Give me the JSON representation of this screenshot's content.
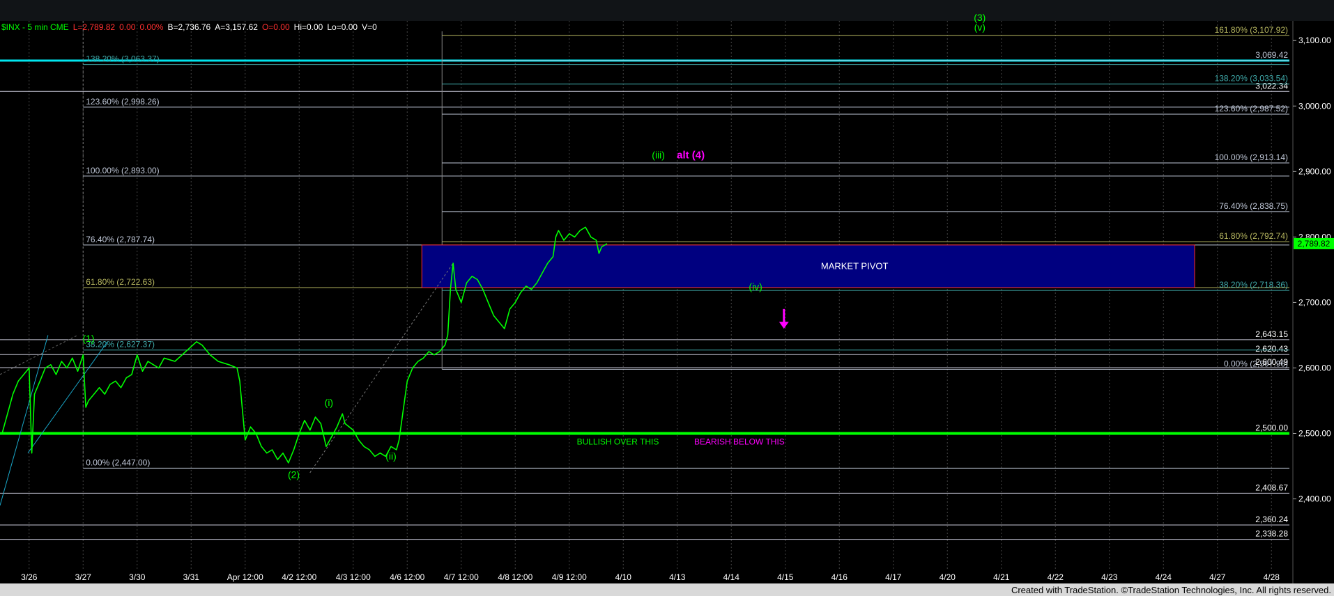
{
  "header": {
    "symbol": "$INX - 5 min CME",
    "last": "L=2,789.82",
    "change": "0.00",
    "change_pct": "0.00%",
    "bid": "B=2,736.76",
    "ask": "A=3,157.62",
    "open": "O=0.00",
    "high": "Hi=0.00",
    "low": "Lo=0.00",
    "volume": "V=0"
  },
  "footer": {
    "credit": "Created with TradeStation. ©TradeStation Technologies, Inc. All rights reserved."
  },
  "colors": {
    "background": "#000000",
    "price": "#00ff00",
    "cyan_line": "#00e5ee",
    "zone_fill": "#000080",
    "zone_border": "#ff2a2a",
    "magenta": "#ff00ff",
    "fib_white": "#c0c8d8",
    "fib_teal": "#3fa9a9",
    "fib_olive": "#b8b860"
  },
  "chart_data": {
    "type": "line",
    "title": "",
    "ylim": [
      2290,
      3130
    ],
    "y_ticks": [
      {
        "v": 2400,
        "label": "2,400.00"
      },
      {
        "v": 2500,
        "label": "2,500.00"
      },
      {
        "v": 2600,
        "label": "2,600.00"
      },
      {
        "v": 2700,
        "label": "2,700.00"
      },
      {
        "v": 2800,
        "label": "2,800.00"
      },
      {
        "v": 2900,
        "label": "2,900.00"
      },
      {
        "v": 3000,
        "label": "3,000.00"
      },
      {
        "v": 3100,
        "label": "3,100.00"
      }
    ],
    "x_ticks": [
      {
        "i": 0.5,
        "label": "3/26"
      },
      {
        "i": 1.5,
        "label": "3/27"
      },
      {
        "i": 2.5,
        "label": "3/30"
      },
      {
        "i": 3.5,
        "label": "3/31"
      },
      {
        "i": 4.5,
        "label": "Apr 12:00"
      },
      {
        "i": 5.5,
        "label": "4/2 12:00"
      },
      {
        "i": 6.5,
        "label": "4/3 12:00"
      },
      {
        "i": 7.5,
        "label": "4/6 12:00"
      },
      {
        "i": 8.5,
        "label": "4/7 12:00"
      },
      {
        "i": 9.5,
        "label": "4/8 12:00"
      },
      {
        "i": 10.5,
        "label": "4/9 12:00"
      },
      {
        "i": 11.5,
        "label": "4/10"
      },
      {
        "i": 12.5,
        "label": "4/13"
      },
      {
        "i": 13.5,
        "label": "4/14"
      },
      {
        "i": 14.5,
        "label": "4/15"
      },
      {
        "i": 15.5,
        "label": "4/16"
      },
      {
        "i": 16.5,
        "label": "4/17"
      },
      {
        "i": 17.5,
        "label": "4/20"
      },
      {
        "i": 18.5,
        "label": "4/21"
      },
      {
        "i": 19.5,
        "label": "4/22"
      },
      {
        "i": 20.5,
        "label": "4/23"
      },
      {
        "i": 21.5,
        "label": "4/24"
      },
      {
        "i": 22.5,
        "label": "4/27"
      },
      {
        "i": 23.5,
        "label": "4/28"
      }
    ],
    "current_price": {
      "value": 2789.82,
      "label": "2,789.82"
    },
    "series": [
      {
        "points": [
          [
            0.0,
            2500
          ],
          [
            0.1,
            2530
          ],
          [
            0.2,
            2560
          ],
          [
            0.3,
            2580
          ],
          [
            0.4,
            2590
          ],
          [
            0.5,
            2600
          ],
          [
            0.55,
            2470
          ],
          [
            0.6,
            2560
          ],
          [
            0.7,
            2580
          ],
          [
            0.8,
            2600
          ],
          [
            0.9,
            2605
          ],
          [
            1.0,
            2590
          ],
          [
            1.1,
            2610
          ],
          [
            1.2,
            2600
          ],
          [
            1.3,
            2615
          ],
          [
            1.4,
            2595
          ],
          [
            1.5,
            2620
          ],
          [
            1.55,
            2540
          ],
          [
            1.6,
            2550
          ],
          [
            1.7,
            2560
          ],
          [
            1.8,
            2570
          ],
          [
            1.9,
            2560
          ],
          [
            2.0,
            2575
          ],
          [
            2.1,
            2580
          ],
          [
            2.2,
            2570
          ],
          [
            2.3,
            2585
          ],
          [
            2.4,
            2590
          ],
          [
            2.5,
            2620
          ],
          [
            2.6,
            2595
          ],
          [
            2.7,
            2610
          ],
          [
            2.8,
            2605
          ],
          [
            2.9,
            2600
          ],
          [
            3.0,
            2615
          ],
          [
            3.2,
            2610
          ],
          [
            3.4,
            2625
          ],
          [
            3.6,
            2640
          ],
          [
            3.7,
            2635
          ],
          [
            3.85,
            2620
          ],
          [
            4.0,
            2610
          ],
          [
            4.2,
            2605
          ],
          [
            4.35,
            2600
          ],
          [
            4.4,
            2580
          ],
          [
            4.5,
            2490
          ],
          [
            4.6,
            2510
          ],
          [
            4.7,
            2500
          ],
          [
            4.8,
            2480
          ],
          [
            4.9,
            2470
          ],
          [
            5.0,
            2475
          ],
          [
            5.1,
            2460
          ],
          [
            5.2,
            2470
          ],
          [
            5.3,
            2455
          ],
          [
            5.4,
            2475
          ],
          [
            5.5,
            2500
          ],
          [
            5.6,
            2520
          ],
          [
            5.7,
            2505
          ],
          [
            5.8,
            2525
          ],
          [
            5.9,
            2515
          ],
          [
            6.0,
            2480
          ],
          [
            6.1,
            2495
          ],
          [
            6.2,
            2510
          ],
          [
            6.3,
            2530
          ],
          [
            6.35,
            2515
          ],
          [
            6.5,
            2505
          ],
          [
            6.6,
            2490
          ],
          [
            6.7,
            2480
          ],
          [
            6.8,
            2475
          ],
          [
            6.9,
            2465
          ],
          [
            7.0,
            2470
          ],
          [
            7.1,
            2465
          ],
          [
            7.2,
            2480
          ],
          [
            7.3,
            2475
          ],
          [
            7.35,
            2490
          ],
          [
            7.5,
            2580
          ],
          [
            7.6,
            2600
          ],
          [
            7.7,
            2610
          ],
          [
            7.8,
            2615
          ],
          [
            7.9,
            2625
          ],
          [
            8.0,
            2620
          ],
          [
            8.1,
            2625
          ],
          [
            8.2,
            2635
          ],
          [
            8.25,
            2650
          ],
          [
            8.3,
            2720
          ],
          [
            8.35,
            2760
          ],
          [
            8.4,
            2720
          ],
          [
            8.5,
            2700
          ],
          [
            8.6,
            2730
          ],
          [
            8.7,
            2740
          ],
          [
            8.8,
            2735
          ],
          [
            8.9,
            2720
          ],
          [
            9.0,
            2700
          ],
          [
            9.1,
            2680
          ],
          [
            9.2,
            2670
          ],
          [
            9.3,
            2660
          ],
          [
            9.4,
            2690
          ],
          [
            9.5,
            2700
          ],
          [
            9.6,
            2715
          ],
          [
            9.7,
            2725
          ],
          [
            9.8,
            2720
          ],
          [
            9.9,
            2730
          ],
          [
            10.0,
            2745
          ],
          [
            10.1,
            2760
          ],
          [
            10.2,
            2770
          ],
          [
            10.25,
            2800
          ],
          [
            10.3,
            2810
          ],
          [
            10.4,
            2795
          ],
          [
            10.5,
            2805
          ],
          [
            10.6,
            2800
          ],
          [
            10.7,
            2810
          ],
          [
            10.8,
            2815
          ],
          [
            10.9,
            2800
          ],
          [
            11.0,
            2795
          ],
          [
            11.05,
            2775
          ],
          [
            11.1,
            2785
          ],
          [
            11.2,
            2789.82
          ]
        ]
      }
    ],
    "horizontal_levels": [
      {
        "v": 3069.42,
        "style": "cyan"
      },
      {
        "v": 3022.34,
        "label": "3,022.34"
      },
      {
        "v": 2643.15,
        "label": "2,643.15"
      },
      {
        "v": 2620.43,
        "label": "2,620.43"
      },
      {
        "v": 2600.49,
        "label": "2,600.49"
      },
      {
        "v": 2500.0,
        "label": "2,500.00",
        "style": "green"
      },
      {
        "v": 2408.67,
        "label": "2,408.67"
      },
      {
        "v": 2360.24,
        "label": "2,360.24"
      },
      {
        "v": 2338.28,
        "label": "2,338.28"
      }
    ],
    "fib_left": {
      "x_start": 1.5,
      "levels": [
        {
          "v": 3063.37,
          "label": "138.20% (3,063.37)",
          "color": "teal"
        },
        {
          "v": 2998.26,
          "label": "123.60% (2,998.26)",
          "color": "white"
        },
        {
          "v": 2893.0,
          "label": "100.00% (2,893.00)",
          "color": "white"
        },
        {
          "v": 2787.74,
          "label": "76.40% (2,787.74)",
          "color": "white"
        },
        {
          "v": 2722.63,
          "label": "61.80% (2,722.63)",
          "color": "olive"
        },
        {
          "v": 2627.37,
          "label": "38.20% (2,627.37)",
          "color": "teal"
        },
        {
          "v": 2447.0,
          "label": "0.00% (2,447.00)",
          "color": "white"
        }
      ]
    },
    "fib_right": {
      "x_start": 7.9,
      "levels": [
        {
          "v": 3107.92,
          "label": "161.80% (3,107.92)",
          "color": "olive"
        },
        {
          "v": 3069.42,
          "label": "3,069.42",
          "color": "white"
        },
        {
          "v": 3033.54,
          "label": "138.20% (3,033.54)",
          "color": "teal"
        },
        {
          "v": 2987.52,
          "label": "123.60% (2,987.52)",
          "color": "white"
        },
        {
          "v": 2913.14,
          "label": "100.00% (2,913.14)",
          "color": "white"
        },
        {
          "v": 2838.75,
          "label": "76.40% (2,838.75)",
          "color": "white"
        },
        {
          "v": 2792.74,
          "label": "61.80% (2,792.74)",
          "color": "olive"
        },
        {
          "v": 2718.36,
          "label": "38.20% (2,718.36)",
          "color": "teal"
        },
        {
          "v": 2597.96,
          "label": "0.00% (2,597.96)",
          "color": "white"
        }
      ]
    },
    "pivot_zone": {
      "x_start": 7.5,
      "x_end": 22.0,
      "y_low": 2722.63,
      "y_high": 2787.74,
      "label": "MARKET PIVOT"
    },
    "wave_labels": [
      {
        "i": 1.6,
        "v": 2640,
        "text": "(1)",
        "color": "green"
      },
      {
        "i": 5.4,
        "v": 2432,
        "text": "(2)",
        "color": "green"
      },
      {
        "i": 6.05,
        "v": 2542,
        "text": "(i)",
        "color": "green"
      },
      {
        "i": 7.2,
        "v": 2460,
        "text": "(ii)",
        "color": "green"
      },
      {
        "i": 12.15,
        "v": 2920,
        "text": "(iii)",
        "color": "green"
      },
      {
        "i": 12.75,
        "v": 2920,
        "text": "alt (4)",
        "color": "magenta"
      },
      {
        "i": 13.95,
        "v": 2719,
        "text": "(iv)",
        "color": "green"
      },
      {
        "i": 18.1,
        "v": 3130,
        "text": "(3)",
        "color": "green"
      },
      {
        "i": 18.1,
        "v": 3115,
        "text": "(v)",
        "color": "green"
      }
    ],
    "annotations": [
      {
        "i": 11.4,
        "v": 2483,
        "text": "BULLISH OVER THIS",
        "color": "green"
      },
      {
        "i": 13.65,
        "v": 2483,
        "text": "BEARISH BELOW THIS",
        "color": "magenta"
      }
    ],
    "arrow": {
      "i": 14.5,
      "v_from": 2690,
      "v_to": 2662,
      "color": "magenta"
    }
  }
}
